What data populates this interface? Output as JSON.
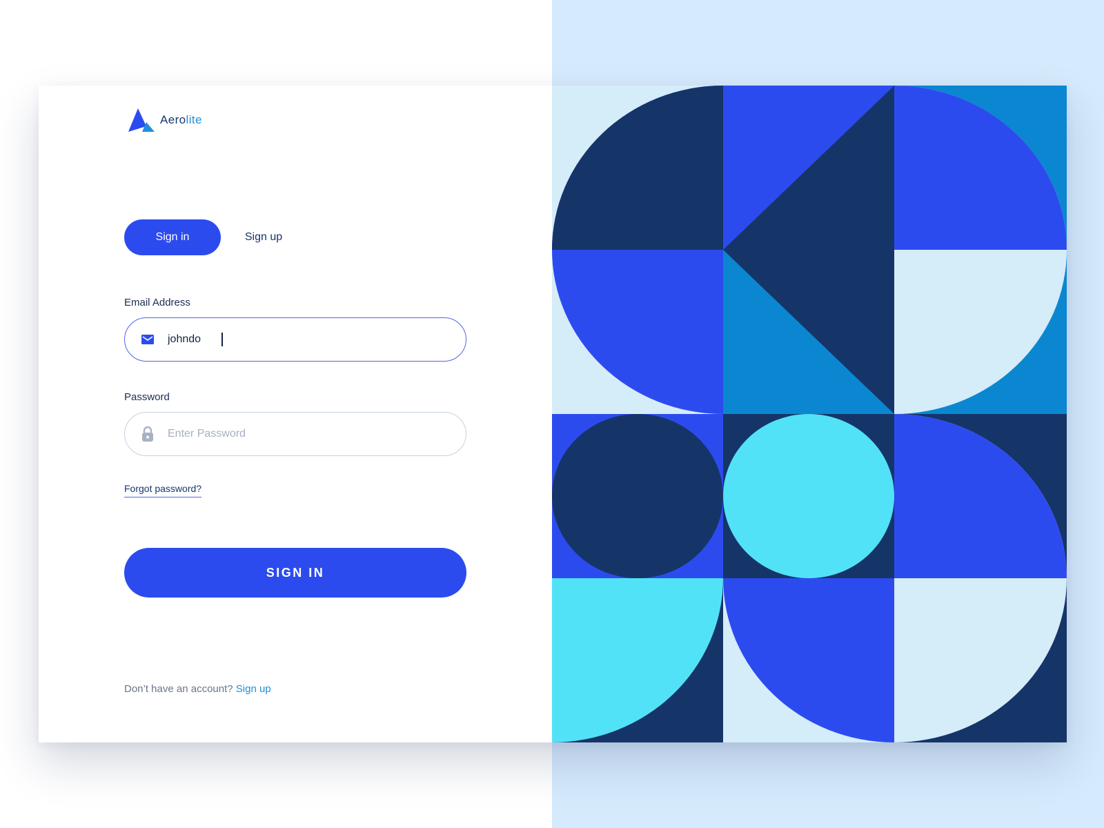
{
  "brand": {
    "name_main": "Aero",
    "name_accent": "lite",
    "colors": {
      "primary": "#2c4bef",
      "accent": "#1f8fd9",
      "navy": "#16356b"
    }
  },
  "tabs": [
    {
      "label": "Sign in",
      "active": true
    },
    {
      "label": "Sign up",
      "active": false
    }
  ],
  "form": {
    "email": {
      "label": "Email Address",
      "value": "johndo",
      "icon": "envelope-icon"
    },
    "password": {
      "label": "Password",
      "value": "",
      "placeholder": "Enter Password",
      "icon": "lock-icon"
    },
    "forgot_label": "Forgot password?",
    "submit_label": "SIGN IN"
  },
  "footer": {
    "prompt": "Don’t have an account?",
    "link_label": "Sign up"
  },
  "artwork": {
    "palette": [
      "#153569",
      "#2c4bef",
      "#0a87d0",
      "#52e2f8",
      "#d5ecf9"
    ]
  }
}
